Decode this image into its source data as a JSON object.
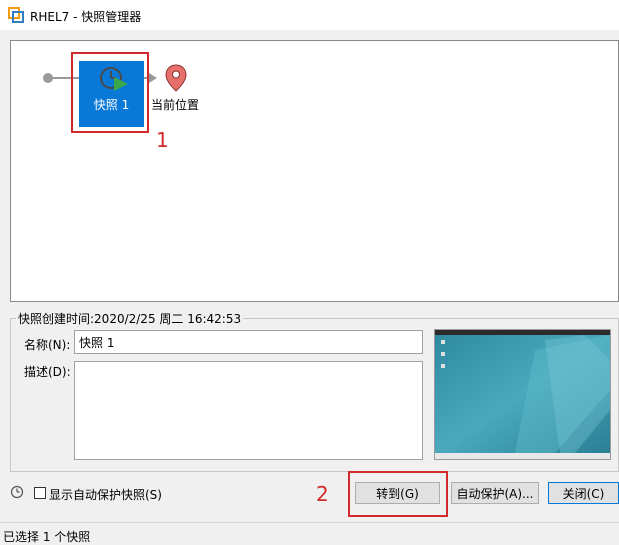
{
  "window": {
    "title": "RHEL7 - 快照管理器",
    "icon": "vmware-app-icon"
  },
  "tree": {
    "snapshot_label": "快照 1",
    "snapshot_icon": "clock-play-icon",
    "current_label": "当前位置",
    "current_icon": "location-pin-icon",
    "selected_color": "#0a78d7",
    "pin_color": "#e8706a"
  },
  "annotations": {
    "marker_1": "1",
    "marker_2": "2",
    "highlight_color": "#d12a2a"
  },
  "details": {
    "created_label": "快照创建时间:2020/2/25 周二 16:42:53",
    "name_label": "名称(N):",
    "name_value": "快照 1",
    "description_label": "描述(D):",
    "description_value": ""
  },
  "bottom": {
    "history_icon": "history-icon",
    "auto_checkbox_label": "显示自动保护快照(S)",
    "auto_checkbox_checked": false,
    "goto_label": "转到(G)",
    "autoprotect_label": "自动保护(A)...",
    "close_label": "关闭(C)"
  },
  "status": {
    "text": "已选择 1 个快照"
  }
}
